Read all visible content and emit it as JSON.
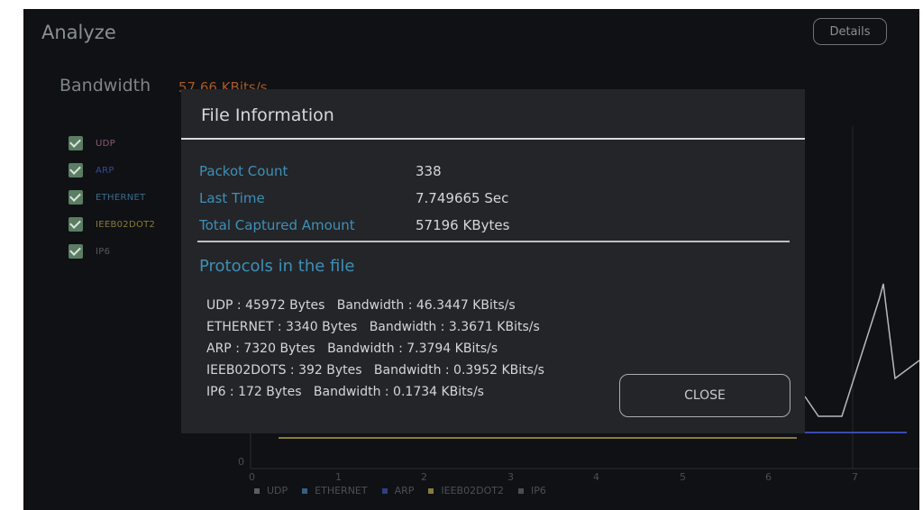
{
  "header": {
    "title": "Analyze",
    "details_label": "Details"
  },
  "bandwidth": {
    "label": "Bandwidth",
    "value": "57.66 KBits/s"
  },
  "legend": [
    {
      "label": "UDP",
      "color": "#8a5a7a",
      "checked": true
    },
    {
      "label": "ARP",
      "color": "#354a94",
      "checked": true
    },
    {
      "label": "ETHERNET",
      "color": "#3a6b8c",
      "checked": true
    },
    {
      "label": "IEEB02DOT2",
      "color": "#8a7a3a",
      "checked": true
    },
    {
      "label": "IP6",
      "color": "#55595e",
      "checked": true
    }
  ],
  "chart": {
    "y_tick": "0",
    "x_ticks": [
      "0",
      "1",
      "2",
      "3",
      "4",
      "5",
      "6",
      "7"
    ],
    "bottom_legend": [
      {
        "label": "UDP",
        "color": "#5a5e63"
      },
      {
        "label": "ETHERNET",
        "color": "#34607f"
      },
      {
        "label": "ARP",
        "color": "#2f3f86"
      },
      {
        "label": "IEEB02DOT2",
        "color": "#8a7a3a"
      },
      {
        "label": "IP6",
        "color": "#4a4e53"
      }
    ]
  },
  "dialog": {
    "title": "File Information",
    "info": [
      {
        "key": "Packot Count",
        "value": "338"
      },
      {
        "key": "Last Time",
        "value": "7.749665 Sec"
      },
      {
        "key": "Total Captured Amount",
        "value": "57196 KBytes"
      }
    ],
    "protocols_title": "Protocols in the file",
    "protocols": [
      "UDP : 45972 Bytes   Bandwidth : 46.3447 KBits/s",
      "ETHERNET : 3340 Bytes   Bandwidth : 3.3671 KBits/s",
      "ARP : 7320 Bytes   Bandwidth : 7.3794 KBits/s",
      "IEEB02DOTS : 392 Bytes   Bandwidth : 0.3952 KBits/s",
      "IP6 : 172 Bytes   Bandwidth : 0.1734 KBits/s"
    ],
    "close_label": "CLOSE"
  }
}
